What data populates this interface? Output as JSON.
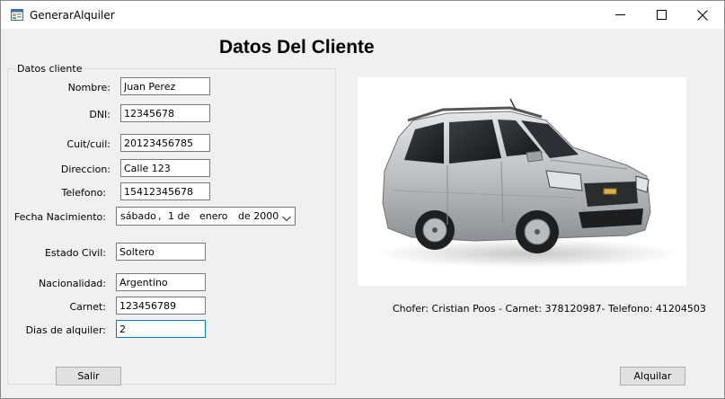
{
  "window": {
    "title": "GenerarAlquiler",
    "icon": "form-app-icon",
    "controls": {
      "minimize": "minimize-icon",
      "maximize": "maximize-icon",
      "close": "close-icon"
    }
  },
  "heading": "Datos Del Cliente",
  "group": {
    "title": "Datos cliente",
    "fields": {
      "nombre": {
        "label": "Nombre:",
        "value": "Juan Perez"
      },
      "dni": {
        "label": "DNI:",
        "value": "12345678"
      },
      "cuit": {
        "label": "Cuit/cuil:",
        "value": "20123456785"
      },
      "direccion": {
        "label": "Direccion:",
        "value": "Calle 123"
      },
      "telefono": {
        "label": "Telefono:",
        "value": "15412345678"
      },
      "fecha": {
        "label": "Fecha Nacimiento:",
        "weekday": "sábado",
        "sep": ",",
        "day": "1 de",
        "month": "enero",
        "year": "de 2000"
      },
      "estado_civil": {
        "label": "Estado Civil:",
        "value": "Soltero"
      },
      "nacionalidad": {
        "label": "Nacionalidad:",
        "value": "Argentino"
      },
      "carnet": {
        "label": "Carnet:",
        "value": "123456789"
      },
      "dias": {
        "label": "Dias de alquiler:",
        "value": "2"
      }
    }
  },
  "buttons": {
    "salir": "Salir",
    "alquilar": "Alquilar"
  },
  "chofer_info": "Chofer: Cristian Poos - Carnet: 378120987- Telefono: 41204503",
  "colors": {
    "focus_border": "#0078d7",
    "car_body": "#c0c4c8",
    "background": "#f0f0f0"
  }
}
